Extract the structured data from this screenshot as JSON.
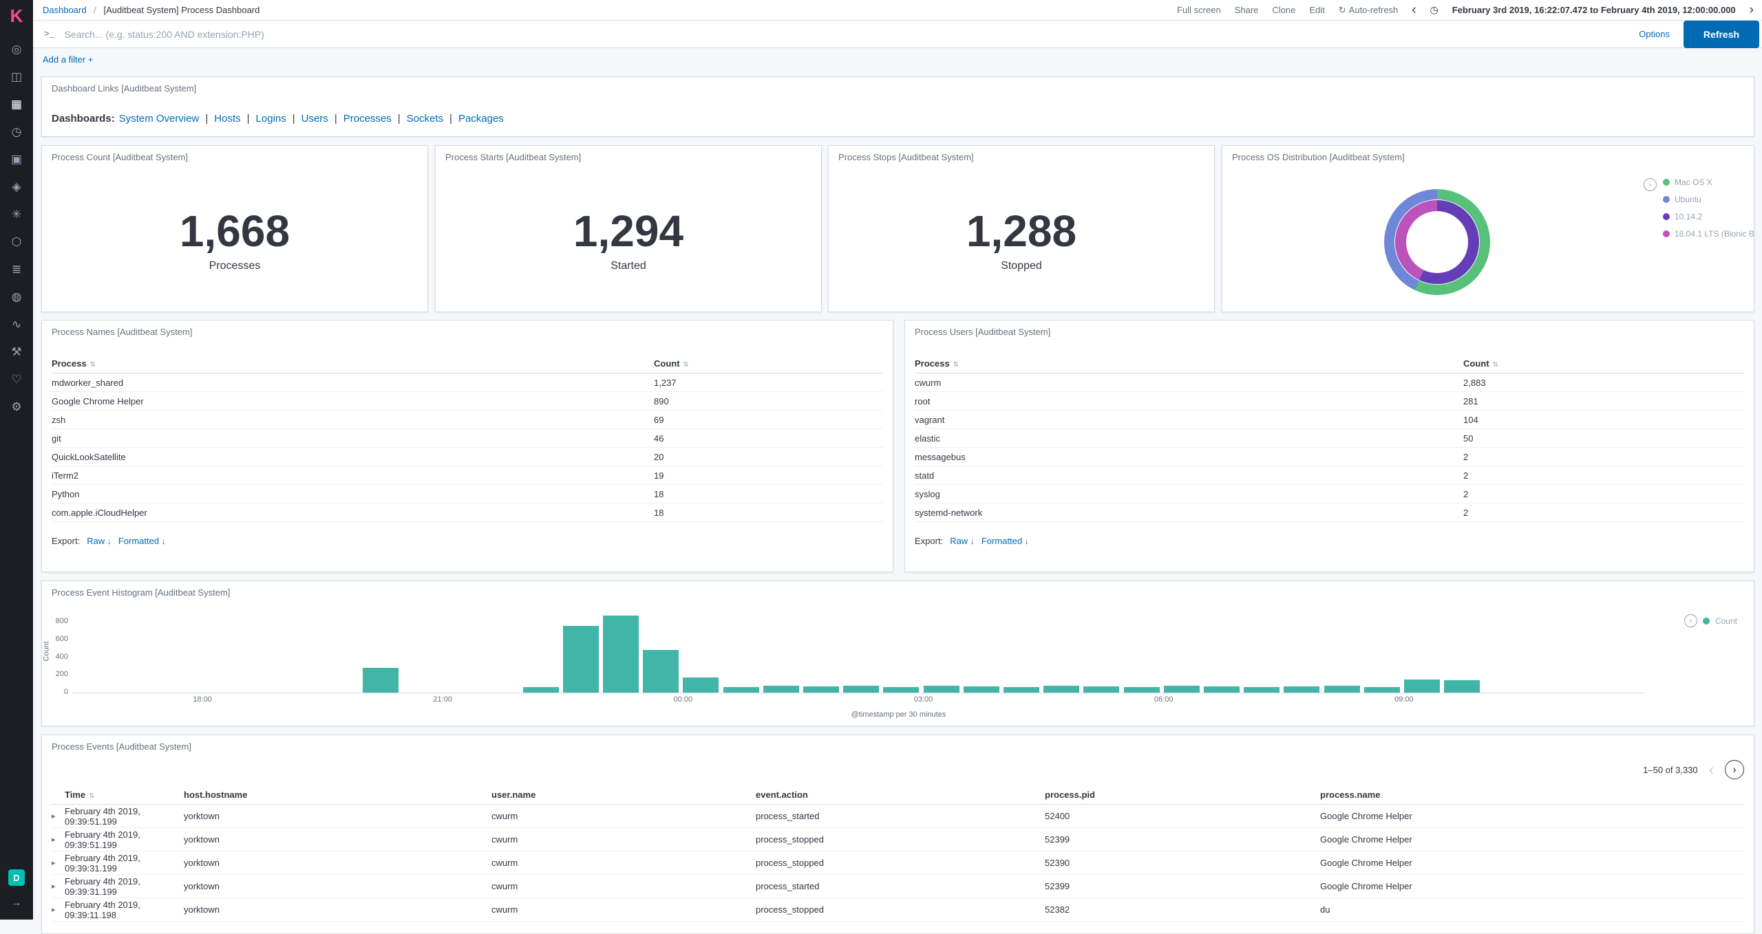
{
  "colors": {
    "brand": "#F04E98",
    "link": "#006BB4",
    "button": "#006BB4",
    "sidebar_bg": "#1D1E24",
    "space_avatar": "#00BFB3"
  },
  "icons": {
    "refresh": "↻",
    "clock": "◷",
    "chevron_left": "‹",
    "chevron_right": "›",
    "prompt": ">_",
    "sort": "⇅",
    "download": "↓",
    "expand": "▸",
    "legend_toggle": "›"
  },
  "sidebar": {
    "logo": "K",
    "space_avatar": "D",
    "collapse_icon": "→",
    "icons": [
      {
        "name": "discover-icon",
        "glyph": "◎"
      },
      {
        "name": "visualize-icon",
        "glyph": "◫"
      },
      {
        "name": "dashboard-icon",
        "glyph": "▦",
        "active": true
      },
      {
        "name": "timelion-icon",
        "glyph": "◷"
      },
      {
        "name": "canvas-icon",
        "glyph": "▣"
      },
      {
        "name": "maps-icon",
        "glyph": "◈"
      },
      {
        "name": "machine-learning-icon",
        "glyph": "✳"
      },
      {
        "name": "infrastructure-icon",
        "glyph": "⬡"
      },
      {
        "name": "logs-icon",
        "glyph": "≣"
      },
      {
        "name": "apm-icon",
        "glyph": "◍"
      },
      {
        "name": "uptime-icon",
        "glyph": "∿"
      },
      {
        "name": "dev-tools-icon",
        "glyph": "⚒"
      },
      {
        "name": "monitoring-icon",
        "glyph": "♡"
      },
      {
        "name": "management-icon",
        "glyph": "⚙"
      }
    ]
  },
  "topnav": {
    "breadcrumb": {
      "link": "Dashboard",
      "separator": "/",
      "title": "[Auditbeat System] Process Dashboard"
    },
    "actions": [
      "Full screen",
      "Share",
      "Clone",
      "Edit"
    ],
    "auto_refresh": "Auto-refresh",
    "time_range": "February 3rd 2019, 16:22:07.472 to February 4th 2019, 12:00:00.000"
  },
  "query_bar": {
    "placeholder": "Search... (e.g. status:200 AND extension:PHP)",
    "options_label": "Options",
    "refresh_label": "Refresh"
  },
  "filter_bar": {
    "add_filter_label": "Add a filter +"
  },
  "panels": {
    "links": {
      "title": "Dashboard Links [Auditbeat System]",
      "prefix": "Dashboards:",
      "links": [
        "System Overview",
        "Hosts",
        "Logins",
        "Users",
        "Processes",
        "Sockets",
        "Packages"
      ]
    },
    "metrics": [
      {
        "title": "Process Count [Auditbeat System]",
        "value": "1,668",
        "label": "Processes"
      },
      {
        "title": "Process Starts [Auditbeat System]",
        "value": "1,294",
        "label": "Started"
      },
      {
        "title": "Process Stops [Auditbeat System]",
        "value": "1,288",
        "label": "Stopped"
      }
    ],
    "os": {
      "title": "Process OS Distribution [Auditbeat System]"
    },
    "process_names": {
      "title": "Process Names [Auditbeat System]",
      "columns": [
        "Process",
        "Count"
      ],
      "rows": [
        [
          "mdworker_shared",
          "1,237"
        ],
        [
          "Google Chrome Helper",
          "890"
        ],
        [
          "zsh",
          "69"
        ],
        [
          "git",
          "46"
        ],
        [
          "QuickLookSatellite",
          "20"
        ],
        [
          "iTerm2",
          "19"
        ],
        [
          "Python",
          "18"
        ],
        [
          "com.apple.iCloudHelper",
          "18"
        ]
      ],
      "export_label": "Export:",
      "raw_label": "Raw",
      "formatted_label": "Formatted"
    },
    "process_users": {
      "title": "Process Users [Auditbeat System]",
      "columns": [
        "Process",
        "Count"
      ],
      "rows": [
        [
          "cwurm",
          "2,883"
        ],
        [
          "root",
          "281"
        ],
        [
          "vagrant",
          "104"
        ],
        [
          "elastic",
          "50"
        ],
        [
          "messagebus",
          "2"
        ],
        [
          "statd",
          "2"
        ],
        [
          "syslog",
          "2"
        ],
        [
          "systemd-network",
          "2"
        ]
      ],
      "export_label": "Export:",
      "raw_label": "Raw",
      "formatted_label": "Formatted"
    },
    "histogram": {
      "title": "Process Event Histogram [Auditbeat System]",
      "legend_label": "Count"
    },
    "process_events": {
      "title": "Process Events [Auditbeat System]",
      "pagination": "1–50 of 3,330",
      "columns": [
        "Time",
        "host.hostname",
        "user.name",
        "event.action",
        "process.pid",
        "process.name"
      ],
      "rows": [
        [
          "February 4th 2019, 09:39:51.199",
          "yorktown",
          "cwurm",
          "process_started",
          "52400",
          "Google Chrome Helper"
        ],
        [
          "February 4th 2019, 09:39:51.199",
          "yorktown",
          "cwurm",
          "process_stopped",
          "52399",
          "Google Chrome Helper"
        ],
        [
          "February 4th 2019, 09:39:31.199",
          "yorktown",
          "cwurm",
          "process_stopped",
          "52390",
          "Google Chrome Helper"
        ],
        [
          "February 4th 2019, 09:39:31.199",
          "yorktown",
          "cwurm",
          "process_started",
          "52399",
          "Google Chrome Helper"
        ],
        [
          "February 4th 2019, 09:39:11.198",
          "yorktown",
          "cwurm",
          "process_stopped",
          "52382",
          "du"
        ]
      ]
    }
  },
  "chart_data": [
    {
      "type": "metric",
      "title": "Process Count [Auditbeat System]",
      "label": "Processes",
      "value": 1668
    },
    {
      "type": "metric",
      "title": "Process Starts [Auditbeat System]",
      "label": "Started",
      "value": 1294
    },
    {
      "type": "metric",
      "title": "Process Stops [Auditbeat System]",
      "label": "Stopped",
      "value": 1288
    },
    {
      "type": "pie",
      "title": "Process OS Distribution [Auditbeat System]",
      "donut": true,
      "legend_position": "right",
      "rings": [
        {
          "position": "outer",
          "slices": [
            {
              "label": "Mac OS X",
              "color": "#57c17b",
              "pct": 57
            },
            {
              "label": "Ubuntu",
              "color": "#6f87d8",
              "pct": 43
            }
          ]
        },
        {
          "position": "inner",
          "slices": [
            {
              "label": "10.14.2",
              "color": "#663db8",
              "pct": 57
            },
            {
              "label": "18.04.1 LTS (Bionic B...",
              "color": "#bc52bc",
              "pct": 43
            }
          ]
        }
      ]
    },
    {
      "type": "bar",
      "title": "Process Event Histogram [Auditbeat System]",
      "xlabel": "@timestamp per 30 minutes",
      "ylabel": "Count",
      "ylim": [
        0,
        900
      ],
      "y_ticks": [
        0,
        200,
        400,
        600,
        800
      ],
      "x_ticks": [
        "18:00",
        "21:00",
        "00:00",
        "03:00",
        "06:00",
        "09:00"
      ],
      "x_domain": [
        "2019-02-03 16:22",
        "2019-02-04 12:00"
      ],
      "bucket_minutes": 30,
      "grid": false,
      "legend_position": "top-right",
      "series": [
        {
          "name": "Count",
          "color": "#41b5a7"
        }
      ],
      "points": [
        [
          "20:00",
          280
        ],
        [
          "22:00",
          60
        ],
        [
          "22:30",
          750
        ],
        [
          "23:00",
          870
        ],
        [
          "23:30",
          480
        ],
        [
          "00:00",
          170
        ],
        [
          "00:30",
          65
        ],
        [
          "01:00",
          80
        ],
        [
          "01:30",
          70
        ],
        [
          "02:00",
          75
        ],
        [
          "02:30",
          65
        ],
        [
          "03:00",
          80
        ],
        [
          "03:30",
          70
        ],
        [
          "04:00",
          65
        ],
        [
          "04:30",
          75
        ],
        [
          "05:00",
          70
        ],
        [
          "05:30",
          65
        ],
        [
          "06:00",
          75
        ],
        [
          "06:30",
          70
        ],
        [
          "07:00",
          65
        ],
        [
          "07:30",
          70
        ],
        [
          "08:00",
          75
        ],
        [
          "08:30",
          65
        ],
        [
          "09:00",
          150
        ],
        [
          "09:30",
          140
        ]
      ]
    },
    {
      "type": "table",
      "title": "Process Names [Auditbeat System]",
      "columns": [
        "Process",
        "Count"
      ],
      "rows": [
        [
          "mdworker_shared",
          1237
        ],
        [
          "Google Chrome Helper",
          890
        ],
        [
          "zsh",
          69
        ],
        [
          "git",
          46
        ],
        [
          "QuickLookSatellite",
          20
        ],
        [
          "iTerm2",
          19
        ],
        [
          "Python",
          18
        ],
        [
          "com.apple.iCloudHelper",
          18
        ]
      ]
    },
    {
      "type": "table",
      "title": "Process Users [Auditbeat System]",
      "columns": [
        "Process",
        "Count"
      ],
      "rows": [
        [
          "cwurm",
          2883
        ],
        [
          "root",
          281
        ],
        [
          "vagrant",
          104
        ],
        [
          "elastic",
          50
        ],
        [
          "messagebus",
          2
        ],
        [
          "statd",
          2
        ],
        [
          "syslog",
          2
        ],
        [
          "systemd-network",
          2
        ]
      ]
    }
  ]
}
